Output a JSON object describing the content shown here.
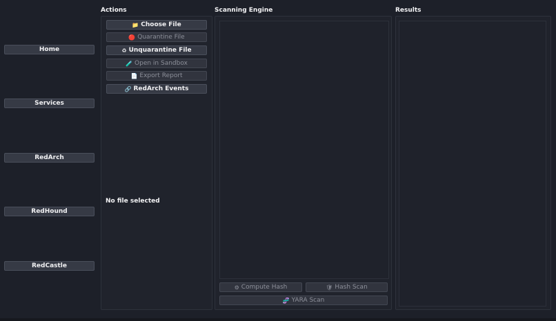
{
  "sidebar": {
    "items": [
      {
        "label": "Home"
      },
      {
        "label": "Services"
      },
      {
        "label": "RedArch"
      },
      {
        "label": "RedHound"
      },
      {
        "label": "RedCastle"
      }
    ]
  },
  "actions": {
    "header": "Actions",
    "choose_file": {
      "icon": "📁",
      "label": "Choose File"
    },
    "quarantine_file": {
      "icon": "🔴",
      "label": "Quarantine File"
    },
    "unquarantine_file": {
      "icon": "♻",
      "label": "Unquarantine File"
    },
    "open_sandbox": {
      "icon": "🧪",
      "label": "Open in Sandbox"
    },
    "export_report": {
      "icon": "📄",
      "label": "Export Report"
    },
    "redarch_events": {
      "icon": "🔗",
      "label": "RedArch Events"
    },
    "status": "No file selected"
  },
  "engine": {
    "header": "Scanning Engine",
    "compute_hash": {
      "icon": "⚙",
      "label": "Compute Hash"
    },
    "hash_scan": {
      "icon": "🛡",
      "label": "Hash Scan"
    },
    "yara_scan": {
      "icon": "🧬",
      "label": "YARA Scan"
    }
  },
  "results": {
    "header": "Results"
  },
  "colors": {
    "background": "#1d2029",
    "button": "#363a45",
    "panel": "#20232c"
  }
}
